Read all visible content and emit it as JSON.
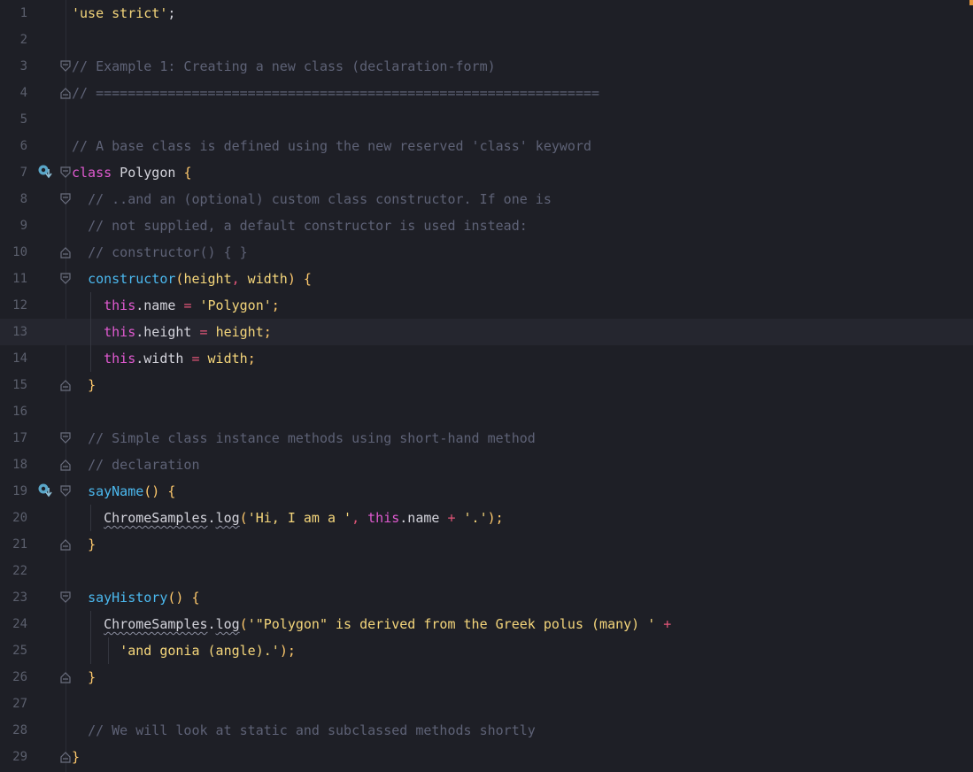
{
  "editor": {
    "current_line": 13,
    "lines": [
      {
        "n": "1",
        "fold": "",
        "bp": false,
        "guides": [],
        "tokens": [
          [
            "str",
            "'use strict'"
          ],
          [
            "pl",
            ";"
          ]
        ]
      },
      {
        "n": "2",
        "fold": "",
        "bp": false,
        "guides": [],
        "tokens": []
      },
      {
        "n": "3",
        "fold": "open",
        "bp": false,
        "guides": [],
        "tokens": [
          [
            "cmt",
            "// Example 1: Creating a new class (declaration-form)"
          ]
        ]
      },
      {
        "n": "4",
        "fold": "close",
        "bp": false,
        "guides": [],
        "tokens": [
          [
            "cmt",
            "// ==============================================================="
          ]
        ]
      },
      {
        "n": "5",
        "fold": "",
        "bp": false,
        "guides": [],
        "tokens": []
      },
      {
        "n": "6",
        "fold": "",
        "bp": false,
        "guides": [],
        "tokens": [
          [
            "cmt",
            "// A base class is defined using the new reserved 'class' keyword"
          ]
        ]
      },
      {
        "n": "7",
        "fold": "open",
        "bp": true,
        "guides": [],
        "tokens": [
          [
            "kw",
            "class"
          ],
          [
            "pl",
            " Polygon "
          ],
          [
            "par",
            "{"
          ]
        ]
      },
      {
        "n": "8",
        "fold": "open",
        "bp": false,
        "guides": [],
        "tokens": [
          [
            "pl",
            "  "
          ],
          [
            "cmt",
            "// ..and an (optional) custom class constructor. If one is"
          ]
        ]
      },
      {
        "n": "9",
        "fold": "",
        "bp": false,
        "guides": [],
        "tokens": [
          [
            "pl",
            "  "
          ],
          [
            "cmt",
            "// not supplied, a default constructor is used instead:"
          ]
        ]
      },
      {
        "n": "10",
        "fold": "close",
        "bp": false,
        "guides": [],
        "tokens": [
          [
            "pl",
            "  "
          ],
          [
            "cmt",
            "// constructor() { }"
          ]
        ]
      },
      {
        "n": "11",
        "fold": "open",
        "bp": false,
        "guides": [],
        "tokens": [
          [
            "pl",
            "  "
          ],
          [
            "fn",
            "constructor"
          ],
          [
            "par",
            "("
          ],
          [
            "str",
            "height"
          ],
          [
            "op",
            ","
          ],
          [
            "str",
            " width"
          ],
          [
            "par",
            ")"
          ],
          [
            "pl",
            " "
          ],
          [
            "par",
            "{"
          ]
        ]
      },
      {
        "n": "12",
        "fold": "",
        "bp": false,
        "guides": [
          1
        ],
        "tokens": [
          [
            "pl",
            "    "
          ],
          [
            "kw",
            "this"
          ],
          [
            "pl",
            ".name "
          ],
          [
            "op",
            "="
          ],
          [
            "pl",
            " "
          ],
          [
            "str",
            "'Polygon'"
          ],
          [
            "par",
            ";"
          ]
        ]
      },
      {
        "n": "13",
        "fold": "",
        "bp": false,
        "guides": [
          1
        ],
        "tokens": [
          [
            "pl",
            "    "
          ],
          [
            "kw",
            "this"
          ],
          [
            "pl",
            ".height "
          ],
          [
            "op",
            "="
          ],
          [
            "pl",
            " "
          ],
          [
            "str",
            "height"
          ],
          [
            "par",
            ";"
          ]
        ]
      },
      {
        "n": "14",
        "fold": "",
        "bp": false,
        "guides": [
          1
        ],
        "tokens": [
          [
            "pl",
            "    "
          ],
          [
            "kw",
            "this"
          ],
          [
            "pl",
            ".width "
          ],
          [
            "op",
            "="
          ],
          [
            "pl",
            " "
          ],
          [
            "str",
            "width"
          ],
          [
            "par",
            ";"
          ]
        ]
      },
      {
        "n": "15",
        "fold": "close",
        "bp": false,
        "guides": [],
        "tokens": [
          [
            "pl",
            "  "
          ],
          [
            "par",
            "}"
          ]
        ]
      },
      {
        "n": "16",
        "fold": "",
        "bp": false,
        "guides": [],
        "tokens": []
      },
      {
        "n": "17",
        "fold": "open",
        "bp": false,
        "guides": [],
        "tokens": [
          [
            "pl",
            "  "
          ],
          [
            "cmt",
            "// Simple class instance methods using short-hand method"
          ]
        ]
      },
      {
        "n": "18",
        "fold": "close",
        "bp": false,
        "guides": [],
        "tokens": [
          [
            "pl",
            "  "
          ],
          [
            "cmt",
            "// declaration"
          ]
        ]
      },
      {
        "n": "19",
        "fold": "open",
        "bp": true,
        "guides": [],
        "tokens": [
          [
            "pl",
            "  "
          ],
          [
            "fn",
            "sayName"
          ],
          [
            "par",
            "()"
          ],
          [
            "pl",
            " "
          ],
          [
            "par",
            "{"
          ]
        ]
      },
      {
        "n": "20",
        "fold": "",
        "bp": false,
        "guides": [
          1
        ],
        "tokens": [
          [
            "pl",
            "    "
          ],
          [
            "sq",
            "ChromeSamples"
          ],
          [
            "pl",
            "."
          ],
          [
            "sq",
            "log"
          ],
          [
            "par",
            "("
          ],
          [
            "str",
            "'Hi, I am a '"
          ],
          [
            "op",
            ","
          ],
          [
            "pl",
            " "
          ],
          [
            "kw",
            "this"
          ],
          [
            "pl",
            ".name "
          ],
          [
            "op",
            "+"
          ],
          [
            "pl",
            " "
          ],
          [
            "str",
            "'.'"
          ],
          [
            "par",
            ");"
          ]
        ]
      },
      {
        "n": "21",
        "fold": "close",
        "bp": false,
        "guides": [],
        "tokens": [
          [
            "pl",
            "  "
          ],
          [
            "par",
            "}"
          ]
        ]
      },
      {
        "n": "22",
        "fold": "",
        "bp": false,
        "guides": [],
        "tokens": []
      },
      {
        "n": "23",
        "fold": "open",
        "bp": false,
        "guides": [],
        "tokens": [
          [
            "pl",
            "  "
          ],
          [
            "fn",
            "sayHistory"
          ],
          [
            "par",
            "()"
          ],
          [
            "pl",
            " "
          ],
          [
            "par",
            "{"
          ]
        ]
      },
      {
        "n": "24",
        "fold": "",
        "bp": false,
        "guides": [
          1
        ],
        "tokens": [
          [
            "pl",
            "    "
          ],
          [
            "sq",
            "ChromeSamples"
          ],
          [
            "pl",
            "."
          ],
          [
            "sq",
            "log"
          ],
          [
            "par",
            "("
          ],
          [
            "str",
            "'\"Polygon\" is derived from the Greek polus (many) '"
          ],
          [
            "pl",
            " "
          ],
          [
            "op",
            "+"
          ]
        ]
      },
      {
        "n": "25",
        "fold": "",
        "bp": false,
        "guides": [
          1,
          2
        ],
        "tokens": [
          [
            "pl",
            "      "
          ],
          [
            "str",
            "'and gonia (angle).'"
          ],
          [
            "par",
            ");"
          ]
        ]
      },
      {
        "n": "26",
        "fold": "close",
        "bp": false,
        "guides": [],
        "tokens": [
          [
            "pl",
            "  "
          ],
          [
            "par",
            "}"
          ]
        ]
      },
      {
        "n": "27",
        "fold": "",
        "bp": false,
        "guides": [],
        "tokens": []
      },
      {
        "n": "28",
        "fold": "",
        "bp": false,
        "guides": [],
        "tokens": [
          [
            "pl",
            "  "
          ],
          [
            "cmt",
            "// We will look at static and subclassed methods shortly"
          ]
        ]
      },
      {
        "n": "29",
        "fold": "close",
        "bp": false,
        "guides": [],
        "tokens": [
          [
            "par",
            "}"
          ]
        ]
      }
    ]
  },
  "colors": {
    "background": "#1e1f26",
    "keyword": "#e05ad0",
    "function": "#4bb8ee",
    "string": "#f5d67b",
    "comment": "#5e6276",
    "punctuation": "#ffc96c",
    "operator": "#e25578"
  },
  "icons": {
    "fold_open": "fold-open-icon",
    "fold_close": "fold-close-icon",
    "breakpoint": "breakpoint-arrow-icon"
  }
}
